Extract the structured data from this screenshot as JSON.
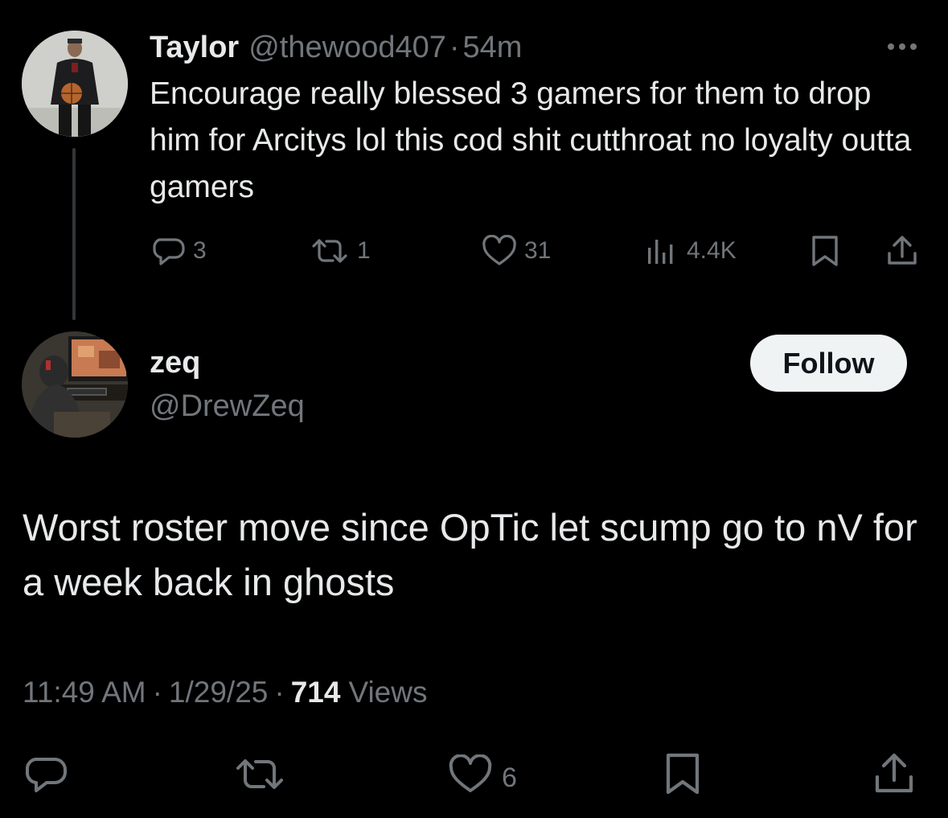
{
  "parent_tweet": {
    "display_name": "Taylor",
    "handle": "@thewood407",
    "separator": "·",
    "time": "54m",
    "text": "Encourage really blessed 3 gamers for them to drop him for Arcitys lol this cod shit cutthroat no loyalty outta gamers",
    "actions": {
      "replies": "3",
      "reposts": "1",
      "likes": "31",
      "views": "4.4K"
    }
  },
  "main_tweet": {
    "display_name": "zeq",
    "handle": "@DrewZeq",
    "follow_label": "Follow",
    "text": "Worst roster move since OpTic let scump go to nV for a week back in ghosts",
    "time": "11:49 AM",
    "date": "1/29/25",
    "separator": "·",
    "views_count": "714",
    "views_label": "Views",
    "likes": "6"
  },
  "icons": {
    "reply": "reply-icon",
    "repost": "repost-icon",
    "like": "like-icon",
    "views": "views-icon",
    "bookmark": "bookmark-icon",
    "share": "share-icon",
    "more": "more-icon"
  },
  "colors": {
    "background": "#000000",
    "primary_text": "#e7e9ea",
    "secondary_text": "#71767b",
    "thread_line": "#333639",
    "follow_bg": "#eff3f4"
  }
}
